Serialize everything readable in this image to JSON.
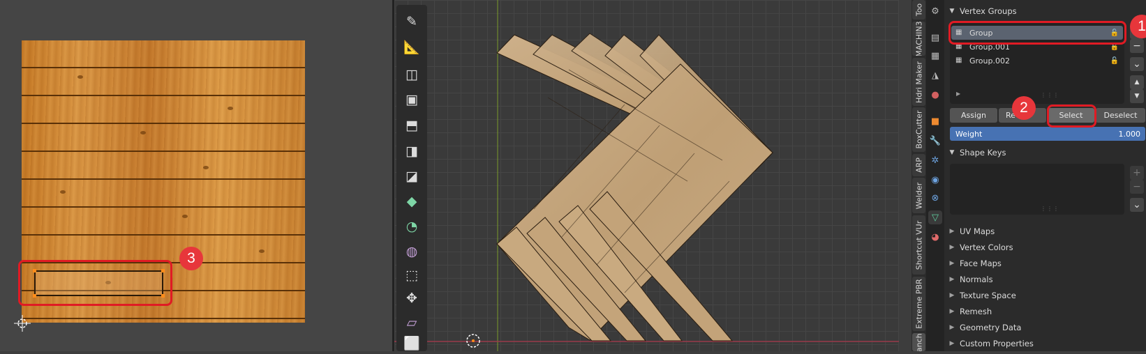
{
  "uv_editor": {
    "callout_number": "3"
  },
  "viewport": {
    "toolbar_icons": [
      "annotate-icon",
      "measure-icon",
      "add-cube-icon",
      "inset-faces-icon",
      "extrude-icon",
      "loop-cut-icon",
      "knife-icon",
      "poly-build-icon",
      "spin-icon",
      "smooth-icon",
      "shrink-fatten-icon",
      "move-icon",
      "shear-icon",
      "transform-box-icon"
    ],
    "sidebar_tabs": [
      "Too",
      "MACHIN3",
      "Hdri Maker",
      "BoxCutter",
      "ARP",
      "Welder",
      "Shortcut VUr",
      "Extreme PBR",
      "Plancher"
    ],
    "active_sidebar_tab": "Plancher"
  },
  "properties": {
    "vertex_groups": {
      "title": "Vertex Groups",
      "items": [
        {
          "name": "Group",
          "selected": true
        },
        {
          "name": "Group.001",
          "selected": false
        },
        {
          "name": "Group.002",
          "selected": false
        }
      ],
      "buttons": {
        "assign": "Assign",
        "remove": "Re",
        "select": "Select",
        "deselect": "Deselect"
      },
      "weight_label": "Weight",
      "weight_value": "1.000"
    },
    "shape_keys": {
      "title": "Shape Keys"
    },
    "collapsed_panels": [
      "UV Maps",
      "Vertex Colors",
      "Face Maps",
      "Normals",
      "Texture Space",
      "Remesh",
      "Geometry Data",
      "Custom Properties"
    ],
    "callouts": {
      "one": "1",
      "two": "2"
    },
    "side_buttons": {
      "add": "+",
      "remove": "−",
      "menu": "⌄",
      "up": "▲",
      "down": "▼"
    }
  },
  "colors": {
    "callout_red": "#e01b24",
    "badge_red": "#e7363b",
    "weight_blue": "#4772b3",
    "selection_orange": "#ff8c1a"
  }
}
